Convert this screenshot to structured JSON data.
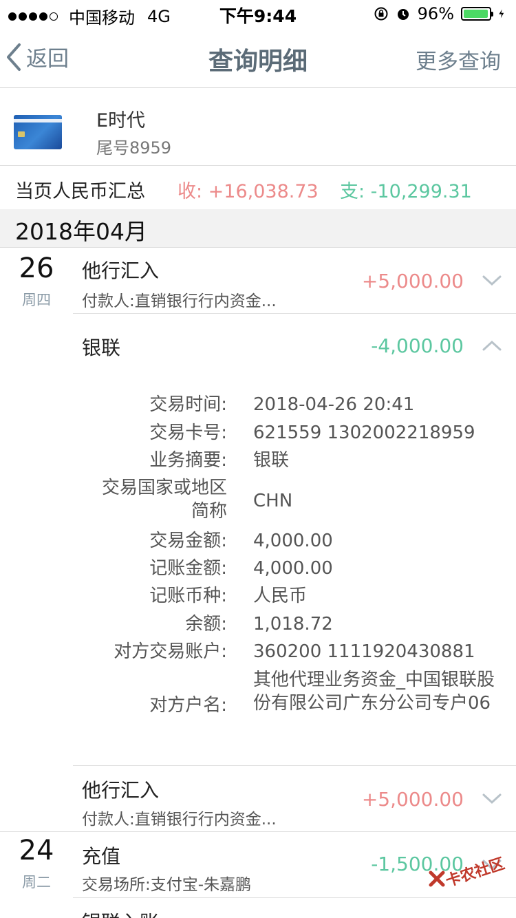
{
  "status_bar": {
    "carrier": "中国移动",
    "network": "4G",
    "time": "下午9:44",
    "battery": "96%",
    "battery_level": 0.96,
    "signal_strength": 4
  },
  "nav": {
    "back": "返回",
    "title": "查询明细",
    "more": "更多查询"
  },
  "card": {
    "name": "E时代",
    "tail": "尾号8959"
  },
  "summary": {
    "label": "当页人民币汇总",
    "income": "收: +16,038.73",
    "expense": "支: -10,299.31"
  },
  "month": "2018年04月",
  "days": [
    {
      "num": "26",
      "weekday": "周四"
    },
    {
      "num": "24",
      "weekday": "周二"
    }
  ],
  "transactions": [
    {
      "title": "他行汇入",
      "subtitle": "付款人:直销银行行内资金...",
      "amount": "+5,000.00",
      "type": "income",
      "expanded": false
    },
    {
      "title": "银联",
      "subtitle": "",
      "amount": "-4,000.00",
      "type": "expense",
      "expanded": true
    },
    {
      "title": "他行汇入",
      "subtitle": "付款人:直销银行行内资金...",
      "amount": "+5,000.00",
      "type": "income",
      "expanded": false
    },
    {
      "title": "充值",
      "subtitle": "交易场所:支付宝-朱嘉鹏",
      "amount": "-1,500.00",
      "type": "expense",
      "expanded": false
    },
    {
      "title": "银联入账",
      "subtitle": "",
      "amount": "",
      "type": "income",
      "expanded": false
    }
  ],
  "details": [
    {
      "label": "交易时间:",
      "value": "2018-04-26 20:41"
    },
    {
      "label": "交易卡号:",
      "value": "621559 1302002218959"
    },
    {
      "label": "业务摘要:",
      "value": "银联"
    },
    {
      "label": "交易国家或地区简称",
      "value": "CHN"
    },
    {
      "label": "交易金额:",
      "value": "4,000.00"
    },
    {
      "label": "记账金额:",
      "value": "4,000.00"
    },
    {
      "label": "记账币种:",
      "value": "人民币"
    },
    {
      "label": "余额:",
      "value": "1,018.72"
    },
    {
      "label": "对方交易账户:",
      "value": "360200 1111920430881"
    },
    {
      "label": "对方户名:",
      "value": "其他代理业务资金_中国银联股份有限公司广东分公司专户06"
    }
  ],
  "watermark": "卡农社区",
  "colors": {
    "income": "#ec8a8a",
    "expense": "#5cc7a0",
    "nav_text": "#6d7f8d",
    "battery": "#4cd964"
  },
  "icons": {
    "back": "chevron-left-icon",
    "expand": "chevron-down-icon",
    "collapse": "chevron-up-icon",
    "lock_rotation": "lock-rotation-icon",
    "alarm": "alarm-icon",
    "charging": "lightning-icon"
  }
}
